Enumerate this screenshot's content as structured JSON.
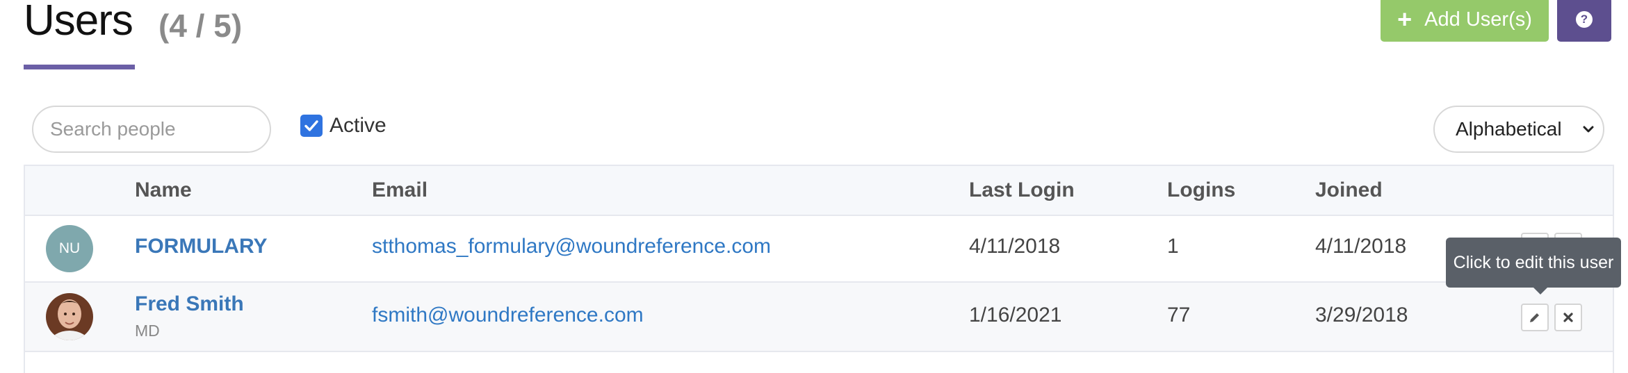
{
  "header": {
    "title": "Users",
    "count": "(4 / 5)",
    "add_button_label": "Add User(s)",
    "accent_color": "#6b5fa6",
    "add_button_color": "#95c96a",
    "help_button_color": "#5d4f8f"
  },
  "filters": {
    "search_placeholder": "Search people",
    "search_value": "",
    "active_label": "Active",
    "active_checked": true,
    "sort_value": "Alphabetical"
  },
  "table": {
    "columns": {
      "name": "Name",
      "email": "Email",
      "last_login": "Last Login",
      "logins": "Logins",
      "joined": "Joined"
    },
    "rows": [
      {
        "avatar_initials": "NU",
        "name": "FORMULARY",
        "subtitle": "",
        "email": "stthomas_formulary@woundreference.com",
        "last_login": "4/11/2018",
        "logins": "1",
        "joined": "4/11/2018"
      },
      {
        "avatar_initials": "",
        "name": "Fred Smith",
        "subtitle": "MD",
        "email": "fsmith@woundreference.com",
        "last_login": "1/16/2021",
        "logins": "77",
        "joined": "3/29/2018"
      }
    ]
  },
  "tooltip": {
    "text": "Click to edit this user"
  },
  "icons": {
    "add": "plus-icon",
    "help": "question-circle-icon",
    "edit": "pencil-icon",
    "delete": "close-icon",
    "sort": "chevron-down-icon",
    "check": "checkmark-icon"
  }
}
